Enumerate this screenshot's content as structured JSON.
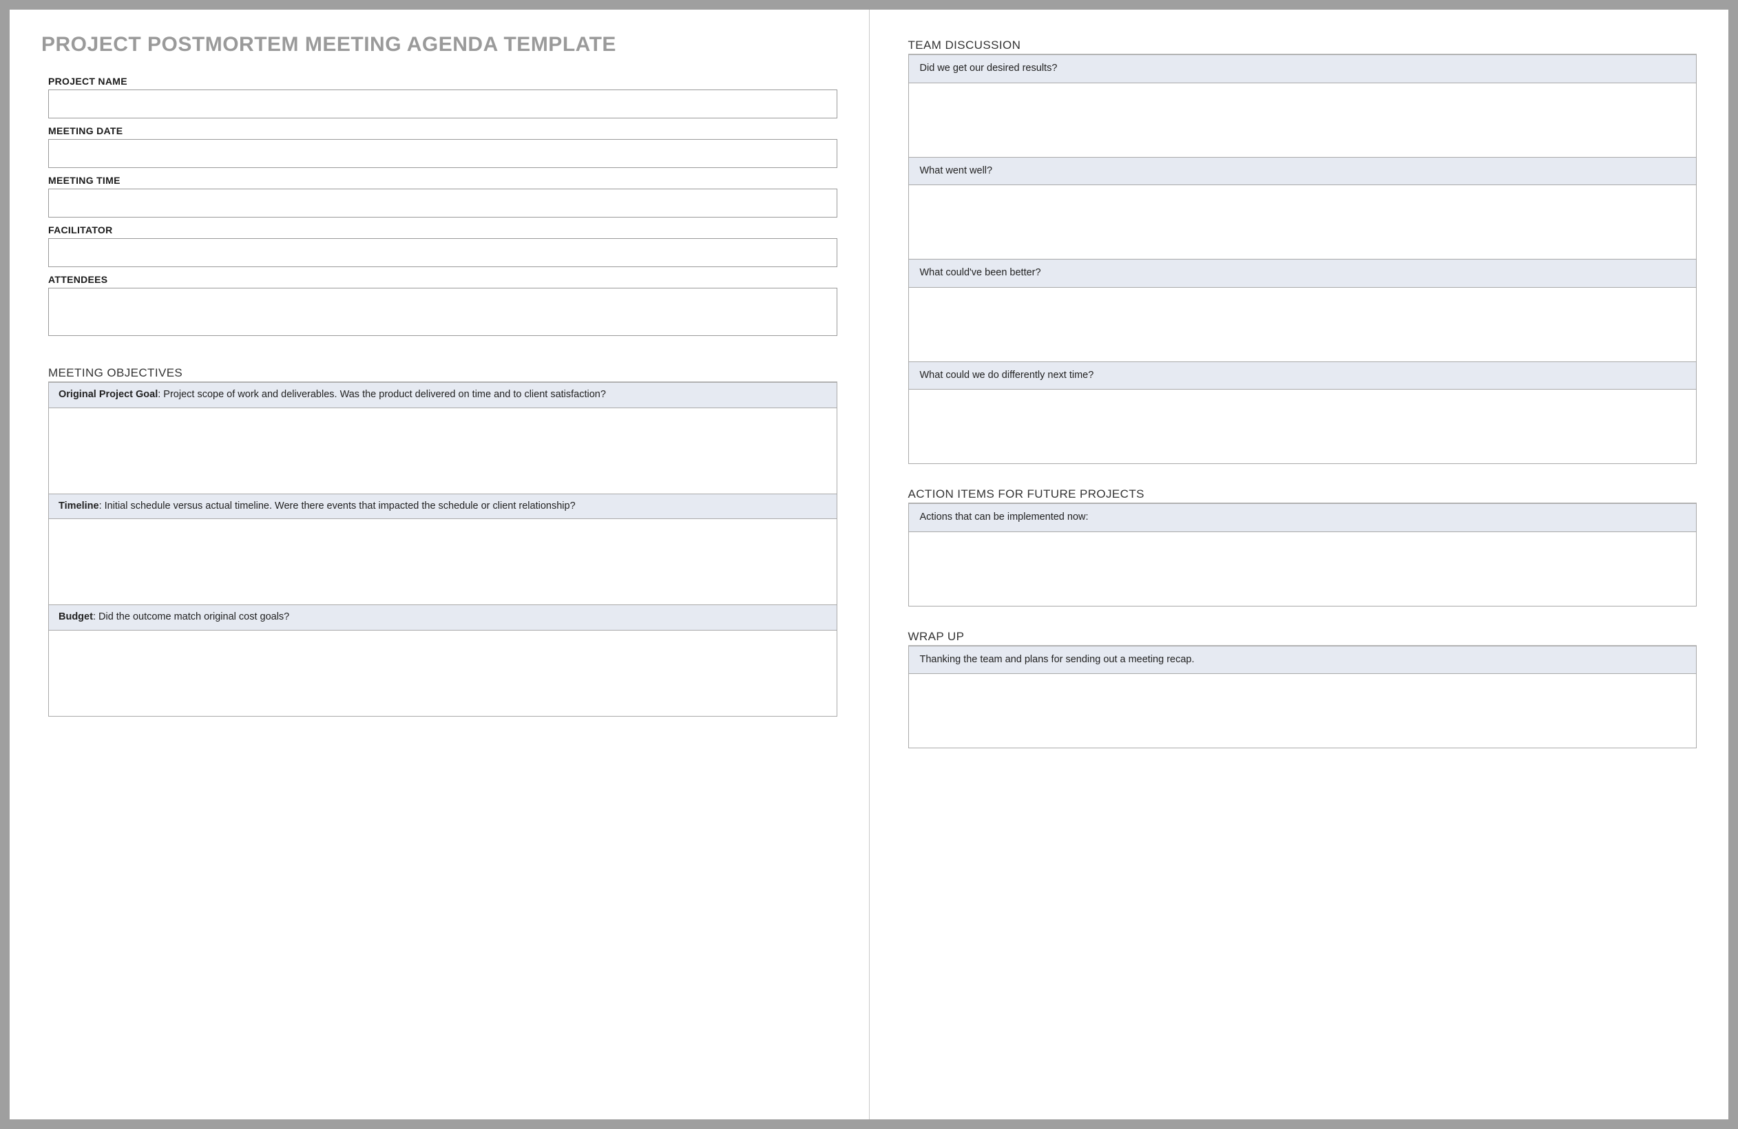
{
  "title": "PROJECT POSTMORTEM MEETING AGENDA TEMPLATE",
  "fields": {
    "project_name": {
      "label": "PROJECT NAME"
    },
    "meeting_date": {
      "label": "MEETING DATE"
    },
    "meeting_time": {
      "label": "MEETING TIME"
    },
    "facilitator": {
      "label": "FACILITATOR"
    },
    "attendees": {
      "label": "ATTENDEES"
    }
  },
  "sections": {
    "objectives": {
      "heading": "MEETING OBJECTIVES",
      "items": [
        {
          "bold": "Original Project Goal",
          "text": ": Project scope of work and deliverables. Was the product delivered on time and to client satisfaction?"
        },
        {
          "bold": "Timeline",
          "text": ": Initial schedule versus actual timeline. Were there events that impacted the schedule or client relationship?"
        },
        {
          "bold": "Budget",
          "text": ": Did the outcome match original cost goals?"
        }
      ]
    },
    "discussion": {
      "heading": "TEAM DISCUSSION",
      "items": [
        {
          "text": "Did we get our desired results?"
        },
        {
          "text": "What went well?"
        },
        {
          "text": "What could've been better?"
        },
        {
          "text": "What could we do differently next time?"
        }
      ]
    },
    "action": {
      "heading": "ACTION ITEMS FOR FUTURE PROJECTS",
      "items": [
        {
          "text": "Actions that can be implemented now:"
        }
      ]
    },
    "wrapup": {
      "heading": "WRAP UP",
      "items": [
        {
          "text": "Thanking the team and plans for sending out a meeting recap."
        }
      ]
    }
  }
}
